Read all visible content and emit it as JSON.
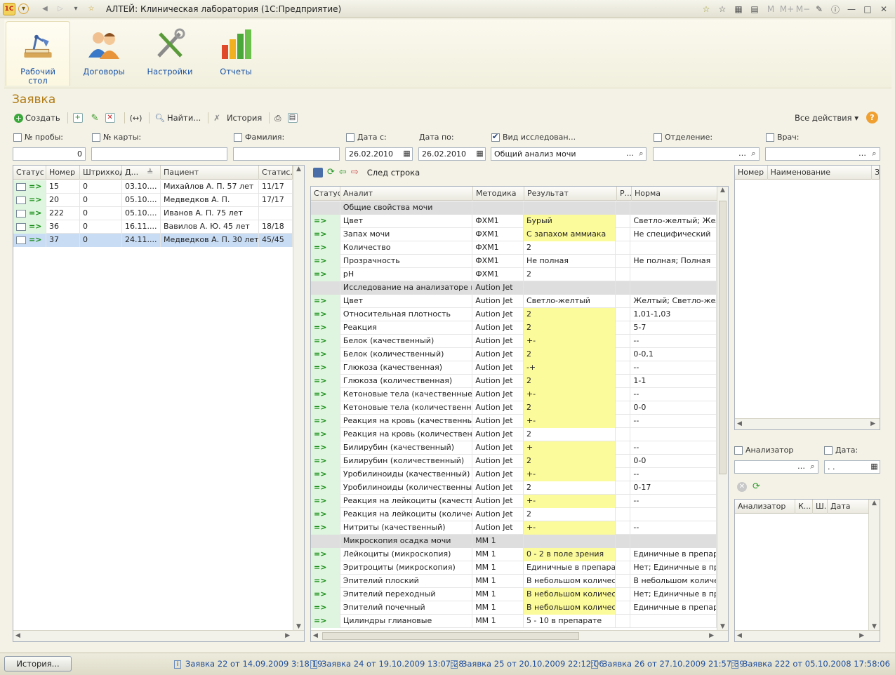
{
  "window": {
    "title": "АЛТЕЙ: Клиническая лаборатория  (1С:Предприятие)",
    "memory": [
      "M",
      "M+",
      "M−"
    ]
  },
  "sections": [
    {
      "label": "Рабочий стол",
      "icon": "desk-lamp-icon"
    },
    {
      "label": "Договоры",
      "icon": "people-icon"
    },
    {
      "label": "Настройки",
      "icon": "tools-icon"
    },
    {
      "label": "Отчеты",
      "icon": "bar-chart-icon"
    }
  ],
  "form": {
    "title": "Заявка"
  },
  "toolbar": {
    "create": "Создать",
    "find": "Найти...",
    "history": "История",
    "all_actions": "Все действия ▾",
    "help": "?"
  },
  "filters": {
    "sample_no": {
      "label": "№ пробы:",
      "value": "0",
      "checked": false
    },
    "card_no": {
      "label": "№ карты:",
      "value": "",
      "checked": false
    },
    "surname": {
      "label": "Фамилия:",
      "value": "",
      "checked": false
    },
    "date_from": {
      "label": "Дата с:",
      "value": "26.02.2010",
      "checked": false
    },
    "date_to": {
      "label": "Дата по:",
      "value": "26.02.2010"
    },
    "research": {
      "label": "Вид исследован...",
      "value": "Общий анализ мочи",
      "checked": true
    },
    "department": {
      "label": "Отделение:",
      "value": "",
      "checked": false
    },
    "doctor": {
      "label": "Врач:",
      "value": "",
      "checked": false
    }
  },
  "orders": {
    "columns": [
      "Статус",
      "Номер",
      "Штрихкод",
      "Д...",
      "Пациент",
      "Статис..."
    ],
    "rows": [
      {
        "number": "15",
        "barcode": "0",
        "date": "03.10....",
        "patient": "Михайлов А. П.  57 лет",
        "stat": "11/17"
      },
      {
        "number": "20",
        "barcode": "0",
        "date": "05.10....",
        "patient": "Медведков А. П.",
        "stat": "17/17"
      },
      {
        "number": "222",
        "barcode": "0",
        "date": "05.10....",
        "patient": "Иванов А. П.  75 лет",
        "stat": ""
      },
      {
        "number": "36",
        "barcode": "0",
        "date": "16.11....",
        "patient": "Вавилов А. Ю.  45 лет",
        "stat": "18/18"
      },
      {
        "number": "37",
        "barcode": "0",
        "date": "24.11....",
        "patient": "Медведков А. П.  30 лет",
        "stat": "45/45"
      }
    ],
    "selected_index": 4
  },
  "analyses": {
    "next_row": "След строка",
    "columns": [
      "Статус",
      "Аналит",
      "Методика",
      "Результат",
      "Р...",
      "Норма"
    ],
    "rows": [
      {
        "g": true,
        "analyte": "Общие свойства мочи",
        "method": "",
        "result": "",
        "norm": ""
      },
      {
        "analyte": "Цвет",
        "method": "ФХМ1",
        "result": "Бурый",
        "y": true,
        "norm": "Светло-желтый; Желть"
      },
      {
        "analyte": "Запах мочи",
        "method": "ФХМ1",
        "result": "С запахом аммиака",
        "y": true,
        "norm": "Не специфический"
      },
      {
        "analyte": "Количество",
        "method": "ФХМ1",
        "result": "2",
        "norm": ""
      },
      {
        "analyte": "Прозрачность",
        "method": "ФХМ1",
        "result": "Не полная",
        "norm": "Не полная; Полная"
      },
      {
        "analyte": "pH",
        "method": "ФХМ1",
        "result": "2",
        "norm": ""
      },
      {
        "g": true,
        "analyte": "Исследование на анализаторе м...",
        "method": "Aution Jet",
        "result": "",
        "norm": ""
      },
      {
        "analyte": "Цвет",
        "method": "Aution Jet",
        "result": "Светло-желтый",
        "norm": "Желтый; Светло-желть"
      },
      {
        "analyte": "Относительная плотность",
        "method": "Aution Jet",
        "result": "2",
        "y": true,
        "norm": "1,01-1,03"
      },
      {
        "analyte": "Реакция",
        "method": "Aution Jet",
        "result": "2",
        "y": true,
        "norm": "5-7"
      },
      {
        "analyte": "Белок (качественный)",
        "method": "Aution Jet",
        "result": "+-",
        "y": true,
        "norm": "--"
      },
      {
        "analyte": "Белок (количественный)",
        "method": "Aution Jet",
        "result": "2",
        "y": true,
        "norm": "0-0,1"
      },
      {
        "analyte": "Глюкоза (качественная)",
        "method": "Aution Jet",
        "result": "-+",
        "y": true,
        "norm": "--"
      },
      {
        "analyte": "Глюкоза (количественная)",
        "method": "Aution Jet",
        "result": "2",
        "y": true,
        "norm": "1-1"
      },
      {
        "analyte": "Кетоновые тела (качественные)",
        "method": "Aution Jet",
        "result": "+-",
        "y": true,
        "norm": "--"
      },
      {
        "analyte": "Кетоновые тела (количественные)",
        "method": "Aution Jet",
        "result": "2",
        "y": true,
        "norm": "0-0"
      },
      {
        "analyte": "Реакция на кровь (качественный)",
        "method": "Aution Jet",
        "result": "+-",
        "y": true,
        "norm": "--"
      },
      {
        "analyte": "Реакция на кровь (количественн...",
        "method": "Aution Jet",
        "result": "2",
        "norm": ""
      },
      {
        "analyte": "Билирубин (качественный)",
        "method": "Aution Jet",
        "result": "+",
        "y": true,
        "norm": "--"
      },
      {
        "analyte": "Билирубин (количественный)",
        "method": "Aution Jet",
        "result": "2",
        "y": true,
        "norm": "0-0"
      },
      {
        "analyte": "Уробилиноиды (качественный)",
        "method": "Aution Jet",
        "result": "+-",
        "y": true,
        "norm": "--"
      },
      {
        "analyte": "Уробилиноиды (количественный)",
        "method": "Aution Jet",
        "result": "2",
        "norm": "0-17"
      },
      {
        "analyte": "Реакция на лейкоциты (качестве...",
        "method": "Aution Jet",
        "result": "+-",
        "y": true,
        "norm": "--"
      },
      {
        "analyte": "Реакция на лейкоциты (количест...",
        "method": "Aution Jet",
        "result": "2",
        "norm": ""
      },
      {
        "analyte": "Нитриты (качественный)",
        "method": "Aution Jet",
        "result": "+-",
        "y": true,
        "norm": "--"
      },
      {
        "g": true,
        "analyte": "Микроскопия осадка мочи",
        "method": "ММ 1",
        "result": "",
        "norm": ""
      },
      {
        "analyte": "Лейкоциты (микроскопия)",
        "method": "ММ 1",
        "result": "0 - 2 в поле зрения",
        "y": true,
        "norm": "Единичные в препарат"
      },
      {
        "analyte": "Эритроциты (микроскопия)",
        "method": "ММ 1",
        "result": "Единичные в препарате.",
        "norm": "Нет; Единичные в преп"
      },
      {
        "analyte": "Эпителий плоский",
        "method": "ММ 1",
        "result": "В небольшом количес...",
        "norm": "В небольшом количест"
      },
      {
        "analyte": "Эпителий переходный",
        "method": "ММ 1",
        "result": "В небольшом количес...",
        "y": true,
        "norm": "Нет; Единичные в преп"
      },
      {
        "analyte": "Эпителий почечный",
        "method": "ММ 1",
        "result": "В небольшом количес...",
        "y": true,
        "norm": "Единичные в препарат"
      },
      {
        "analyte": "Цилиндры глиановые",
        "method": "ММ 1",
        "result": "5 - 10 в препарате",
        "norm": ""
      }
    ]
  },
  "right_top": {
    "columns": [
      "Номер",
      "Наименование",
      "З"
    ]
  },
  "right_filters": {
    "analyzer": {
      "label": "Анализатор",
      "value": ""
    },
    "date": {
      "label": "Дата:",
      "value": ". ."
    }
  },
  "right_bottom": {
    "columns": [
      "Анализатор",
      "К...",
      "Ш.",
      "Дата"
    ]
  },
  "status_bar": {
    "history": "История...",
    "links": [
      "Заявка 22 от 14.09.2009 3:18:19",
      "Заявка 24 от 19.10.2009 13:07:28",
      "Заявка 25 от 20.10.2009 22:12:06",
      "Заявка 26 от 27.10.2009 21:57:39",
      "Заявка 222 от 05.10.2008 17:58:06"
    ]
  },
  "colors": {
    "accent": "#b07a12",
    "link": "#1c55a8",
    "highlight": "#fcfb9c",
    "selection": "#c8dcf4",
    "status_ok": "#118a11"
  }
}
